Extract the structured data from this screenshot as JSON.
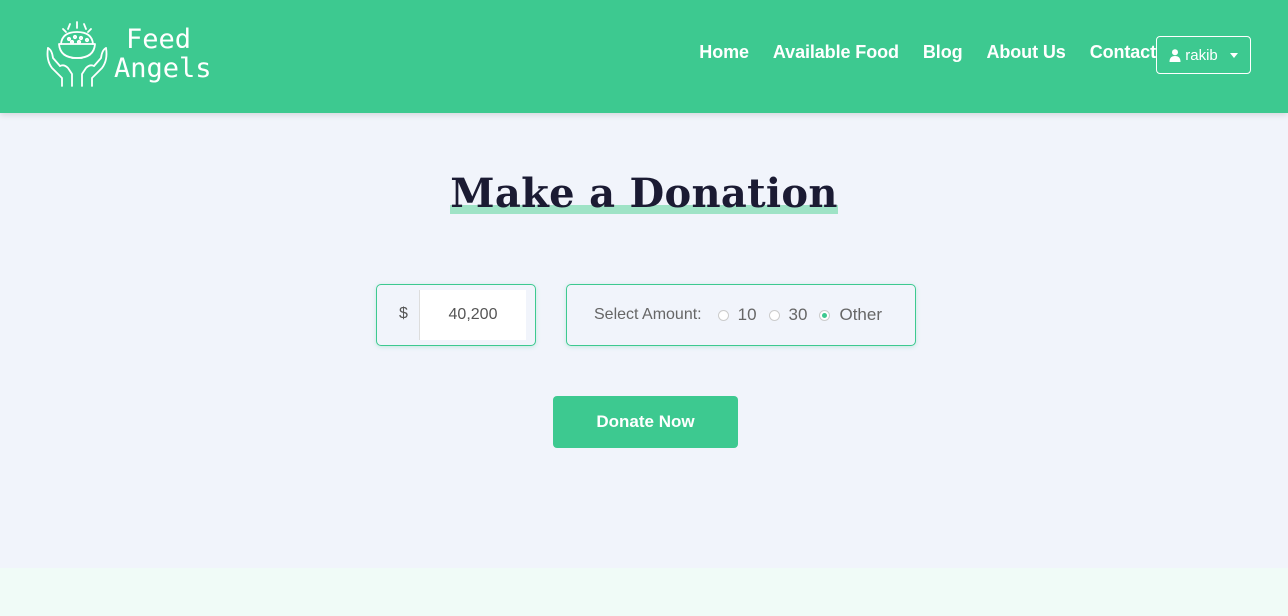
{
  "brand": {
    "line1": "Feed",
    "line2": "Angels",
    "icon": "hands-holding-bowl-icon"
  },
  "nav": {
    "items": [
      "Home",
      "Available Food",
      "Blog",
      "About Us",
      "Contact"
    ]
  },
  "user_menu": {
    "label": "rakib",
    "icon": "user-icon"
  },
  "donation": {
    "title": "Make a Donation",
    "currency_symbol": "$",
    "amount_value": "40,200",
    "select_label": "Select Amount:",
    "options": [
      {
        "label": "10",
        "checked": false
      },
      {
        "label": "30",
        "checked": false
      },
      {
        "label": "Other",
        "checked": true
      }
    ],
    "button_label": "Donate Now"
  },
  "colors": {
    "accent": "#3dc990",
    "background": "#f1f4fb",
    "title": "#1b1b33",
    "highlight": "#9fe3c6"
  }
}
